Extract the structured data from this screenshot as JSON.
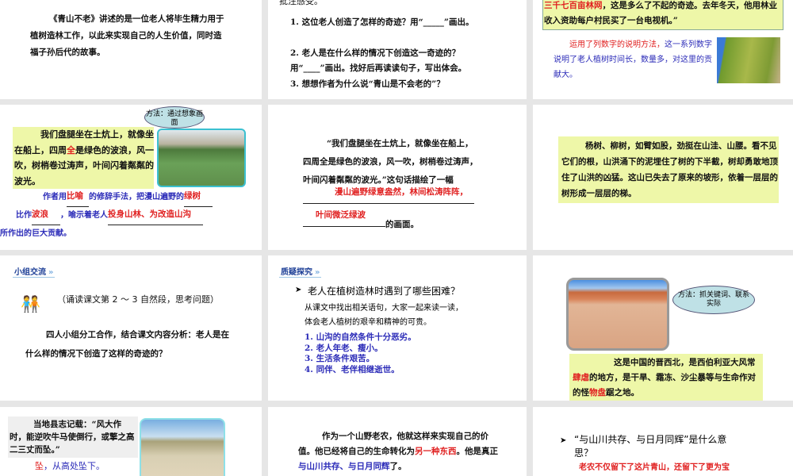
{
  "slides": [
    {
      "body": "《青山不老》讲述的是一位老人将毕生精力用于植树造林工作，以此来实现自己的人生价值，同时造福子孙后代的故事。"
    },
    {
      "top": "批注感受。",
      "q1": "1. 这位老人创造了怎样的奇迹？用“_____”画出。",
      "q2": "2. 老人是在什么样的情况下创造这一奇迹的？用“____”画出。找好后再读读句子，写出体会。",
      "q3": "3. 想想作者为什么说“青山是不会老的”？"
    },
    {
      "quote_red": "三千七百亩林网",
      "quote_rest": "，这是多么了不起的奇迹。去年冬天，他用林业收入资助每户村民买了一台电视机。”",
      "note_red": "运用了列数字的说明方法，",
      "note_blue": "这一系列数字说明了老人植树时间长，数量多，对这里的贡献大。"
    },
    {
      "bubble": "方法：通过想象画面",
      "quote_a": "我们盘腿坐在土炕上，就像坐在船上，四周",
      "quote_red": "全",
      "quote_b": "是绿色的波浪，风一吹，树梢卷过涛声，叶间闪着粼粼的波光。",
      "fill_a": "作者用",
      "ans1": "比喻",
      "fill_b": "的修辞手法，把漫山遍野的",
      "ans2": "绿树",
      "fill_c": "比作",
      "ans3": "波浪",
      "fill_d": "，喻示着老人",
      "ans4": "投身山林、为改造山沟",
      "fill_e": "所作出的巨大贡献。"
    },
    {
      "line1": "“我们盘腿坐在土炕上，就像坐在船上，",
      "line2": "四周全是绿色的波浪，风一吹，树梢卷过涛声，",
      "line3": "叶间闪着粼粼的波光。”这句话描绘了一幅",
      "ans1": "漫山遍野绿意盎然，林间松涛阵阵，",
      "ans2": "叶间微泛绿波",
      "end": "的画面。"
    },
    {
      "body": "杨树、柳树，如臂如股，劲挺在山洼、山腰。看不见它们的根，山洪涌下的泥埋住了树的下半截，树却勇敢地顶住了山洪的凶猛。这山已失去了原来的坡形，依着一层层的树形成一层层的梯。"
    },
    {
      "tag": "小组交流",
      "instr": "（诵读课文第 2 ～ 3 自然段，思考问题）",
      "body": "四人小组分工合作，结合课文内容分析：老人是在什么样的情况下创造了这样的奇迹的？"
    },
    {
      "tag": "质疑探究",
      "question": "老人在植树造林时遇到了哪些困难？",
      "intro": "从课文中找出相关语句，大家一起来读一读，体会老人植树的艰辛和精神的可贵。",
      "items": [
        "1. 山沟的自然条件十分恶劣。",
        "2. 老人年老、瘦小。",
        "3. 生活条件艰苦。",
        "4. 同伴、老伴相继逝世。"
      ]
    },
    {
      "bubble": "方法：抓关键词、联系实际",
      "a": "这是中国的晋西北，是西伯利亚大风常",
      "r1": "肆虐",
      "b": "的地方，是干旱、霜冻、沙尘暴等与生命作对的怪",
      "r2": "物盘",
      "c": "踞之地。"
    },
    {
      "quote": "当地县志记载：“风大作时，能逆吹牛马使倒行，或擎之高二三丈而坠。”",
      "def_red": "坠",
      "def_blue": "，从高处坠下。"
    },
    {
      "a": "作为一个山野老农，他就这样来实现自己的价值。他已经将自己的生命转化为",
      "red": "另一种东西",
      "b": "。他是真正",
      "blue": "与山川共存、与日月同辉",
      "c": "了。"
    },
    {
      "question": "“与山川共存、与日月同辉”是什么意思？",
      "answer": "老农不仅留下了这片青山，还留下了更为宝"
    }
  ]
}
